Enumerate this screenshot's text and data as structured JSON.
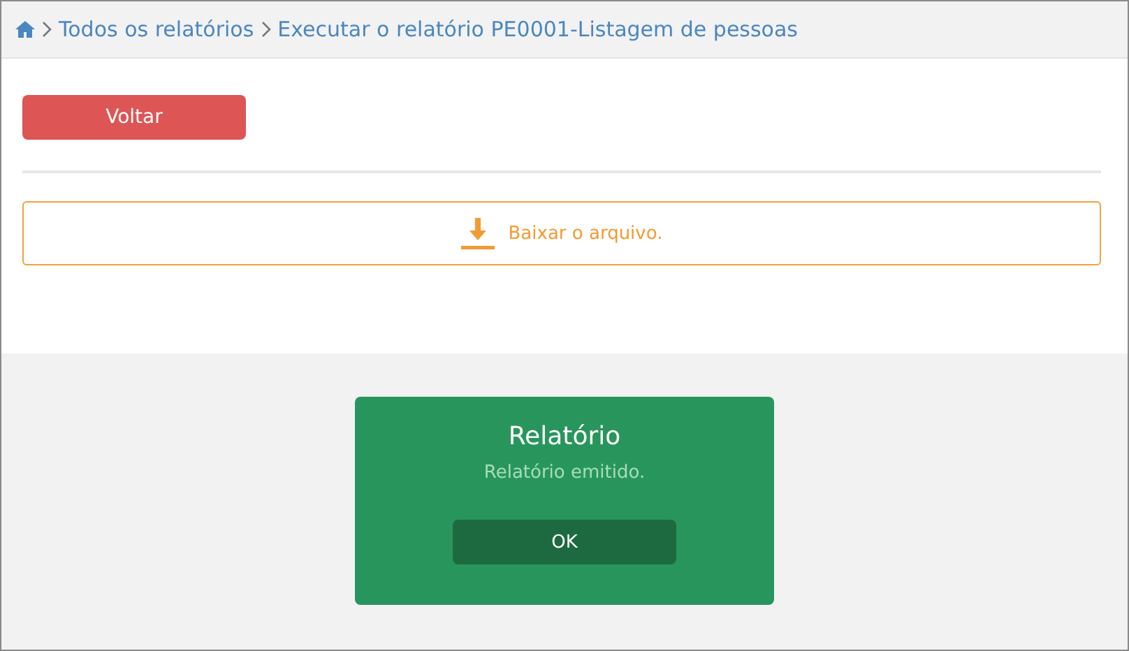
{
  "breadcrumb": [
    {
      "label": "Todos os relatórios"
    },
    {
      "label": "Executar o relatório PE0001-Listagem de pessoas"
    }
  ],
  "back_button": {
    "label": "Voltar"
  },
  "download": {
    "label": "Baixar o arquivo."
  },
  "dialog": {
    "title": "Relatório",
    "message": "Relatório emitido.",
    "button": "OK"
  }
}
